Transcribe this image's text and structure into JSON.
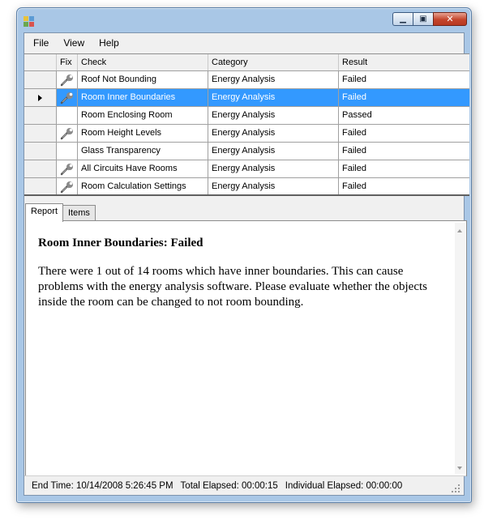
{
  "window": {
    "title": "",
    "icon": "app-icon",
    "controls": {
      "minimize": "minimize-icon",
      "maximize": "maximize-icon",
      "close": "close-icon"
    }
  },
  "menu": {
    "items": [
      {
        "label": "File"
      },
      {
        "label": "View"
      },
      {
        "label": "Help"
      }
    ]
  },
  "grid": {
    "columns": {
      "fix": "Fix",
      "check": "Check",
      "category": "Category",
      "result": "Result"
    },
    "selected_index": 1,
    "rows": [
      {
        "has_fix": true,
        "check": "Roof Not Bounding",
        "category": "Energy Analysis",
        "result": "Failed"
      },
      {
        "has_fix": true,
        "check": "Room Inner Boundaries",
        "category": "Energy Analysis",
        "result": "Failed"
      },
      {
        "has_fix": false,
        "check": "Room Enclosing Room",
        "category": "Energy Analysis",
        "result": "Passed"
      },
      {
        "has_fix": true,
        "check": "Room Height Levels",
        "category": "Energy Analysis",
        "result": "Failed"
      },
      {
        "has_fix": false,
        "check": "Glass Transparency",
        "category": "Energy Analysis",
        "result": "Failed"
      },
      {
        "has_fix": true,
        "check": "All Circuits Have Rooms",
        "category": "Energy Analysis",
        "result": "Failed"
      },
      {
        "has_fix": true,
        "check": "Room Calculation Settings",
        "category": "Energy Analysis",
        "result": "Failed"
      }
    ]
  },
  "tabs": [
    {
      "label": "Report",
      "active": true
    },
    {
      "label": "Items",
      "active": false
    }
  ],
  "report": {
    "heading": "Room Inner Boundaries: Failed",
    "body": "There were 1 out of 14 rooms which have inner boundaries. This can cause problems with the energy analysis software. Please evaluate whether the objects inside the room can be changed to not room bounding."
  },
  "status": {
    "end_time": "End Time: 10/14/2008 5:26:45 PM",
    "total_elapsed": "Total Elapsed: 00:00:15",
    "individual_elapsed": "Individual Elapsed: 00:00:00"
  },
  "colors": {
    "selection": "#3399ff",
    "title_bar": "#a9c7e6",
    "close_button": "#c4452c"
  }
}
